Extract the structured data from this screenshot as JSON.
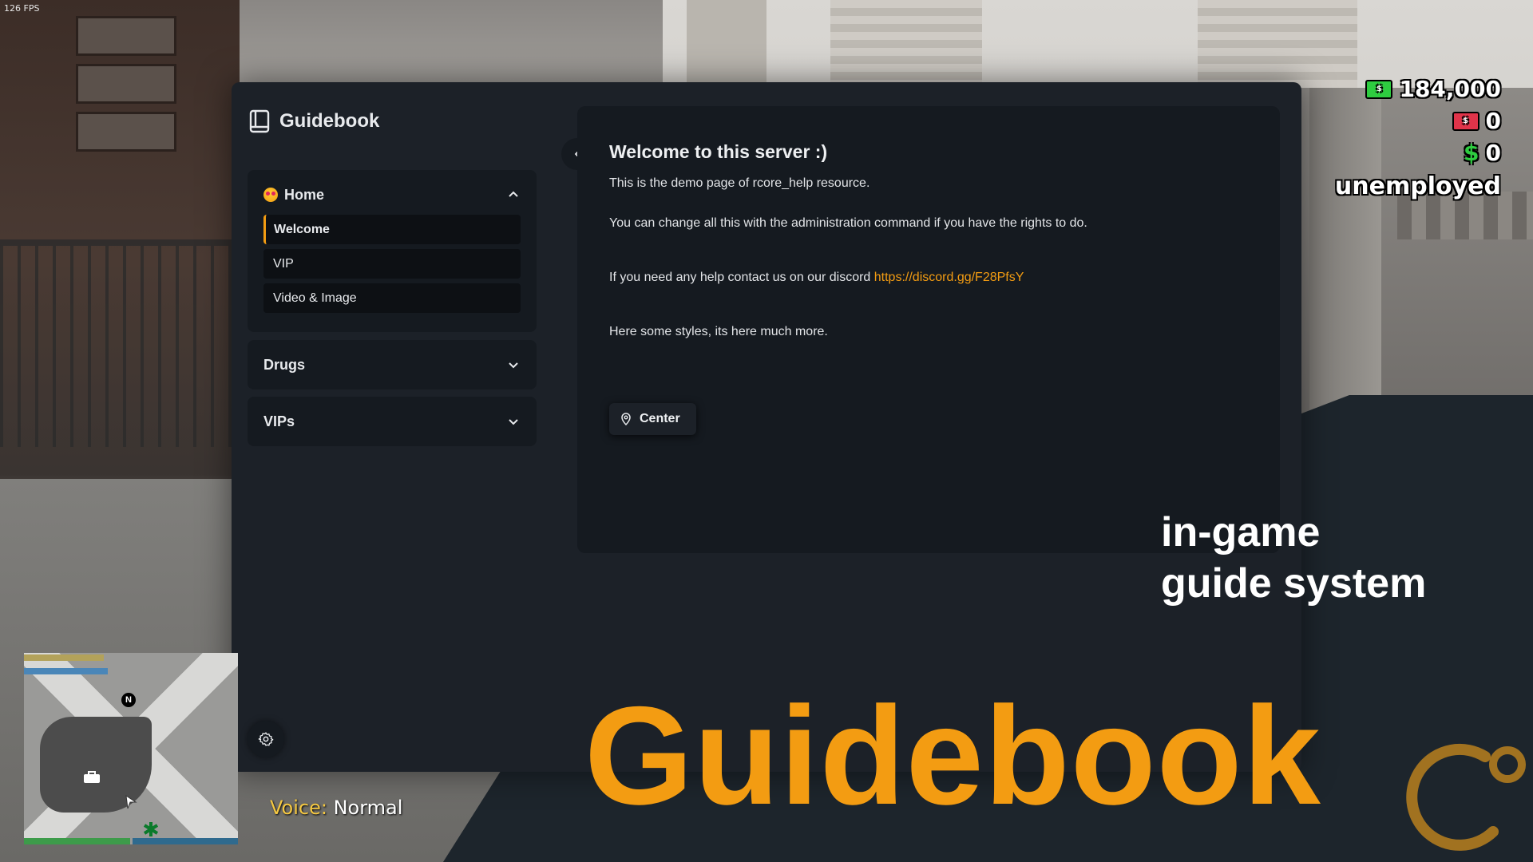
{
  "hud": {
    "fps": "126 FPS",
    "money_bank": "184,000",
    "money_black": "0",
    "money_cash": "0",
    "job": "unemployed",
    "voice_label": "Voice:",
    "voice_value": "Normal",
    "compass": "N"
  },
  "guidebook": {
    "title": "Guidebook",
    "sections": [
      {
        "title": "Home",
        "expanded": true,
        "items": [
          "Welcome",
          "VIP",
          "Video & Image"
        ],
        "active": "Welcome"
      },
      {
        "title": "Drugs",
        "expanded": false
      },
      {
        "title": "VIPs",
        "expanded": false
      }
    ],
    "page": {
      "title": "Welcome to this server :)",
      "line1": "This is the demo page of rcore_help resource.",
      "line2": "You can change all this with the administration command if you have the rights to do.",
      "line3_prefix": "If you need any help contact us on our discord ",
      "line3_link": "https://discord.gg/F28PfsY",
      "line4": "Here some styles, its here much more.",
      "center_button": "Center"
    }
  },
  "banner": {
    "tagline_line1": "in-game",
    "tagline_line2": "guide system",
    "headline": "Guidebook"
  },
  "colors": {
    "accent": "#f39c12",
    "panel": "#1c2128",
    "card": "#151a20",
    "banner_dark": "#1d252c"
  }
}
